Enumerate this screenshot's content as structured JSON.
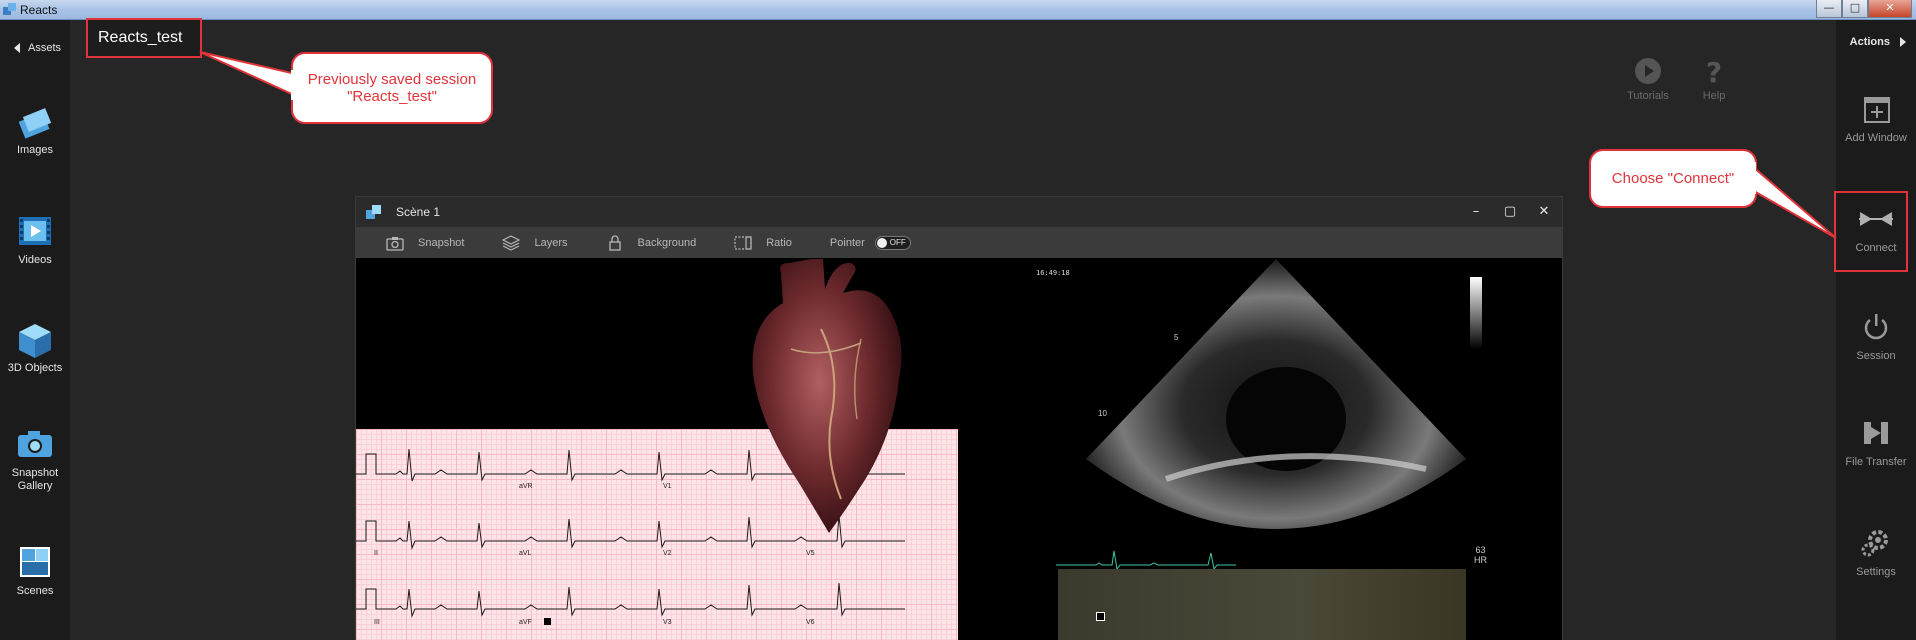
{
  "os_window": {
    "title": "Reacts",
    "controls": [
      "minimize",
      "maximize",
      "close"
    ]
  },
  "left_sidebar": {
    "back_label": "Assets",
    "items": [
      {
        "label": "Images",
        "icon": "images-icon"
      },
      {
        "label": "Videos",
        "icon": "videos-icon"
      },
      {
        "label": "3D Objects",
        "icon": "cube-icon"
      },
      {
        "label": "Snapshot Gallery",
        "icon": "camera-icon"
      },
      {
        "label": "Scenes",
        "icon": "scenes-icon"
      }
    ]
  },
  "header": {
    "session_name": "Reacts_test",
    "tools": [
      {
        "label": "Tutorials",
        "icon": "play-icon"
      },
      {
        "label": "Help",
        "icon": "question-icon"
      }
    ]
  },
  "right_sidebar": {
    "actions_label": "Actions",
    "items": [
      {
        "label": "Add Window",
        "icon": "add-window-icon"
      },
      {
        "label": "Connect",
        "icon": "connect-icon"
      },
      {
        "label": "Session",
        "icon": "power-icon"
      },
      {
        "label": "File Transfer",
        "icon": "file-transfer-icon"
      },
      {
        "label": "Settings",
        "icon": "settings-icon"
      }
    ]
  },
  "annotations": {
    "session_callout": "Previously saved session \"Reacts_test\"",
    "connect_callout": "Choose \"Connect\"",
    "accent_color": "#e0343a"
  },
  "scene": {
    "title": "Scène 1",
    "toolbar": {
      "snapshot": "Snapshot",
      "layers": "Layers",
      "background": "Background",
      "ratio": "Ratio",
      "pointer": "Pointer",
      "pointer_state": "OFF"
    },
    "ecg_leads": [
      "aVR",
      "V1",
      "V4",
      "II",
      "aVL",
      "V2",
      "V5",
      "III",
      "aVF",
      "V3",
      "V6"
    ],
    "echo": {
      "time": "16:49:18",
      "marker_v": "V",
      "depth_marks": [
        "5",
        "10"
      ],
      "hr_value": "63",
      "hr_label": "HR"
    }
  }
}
